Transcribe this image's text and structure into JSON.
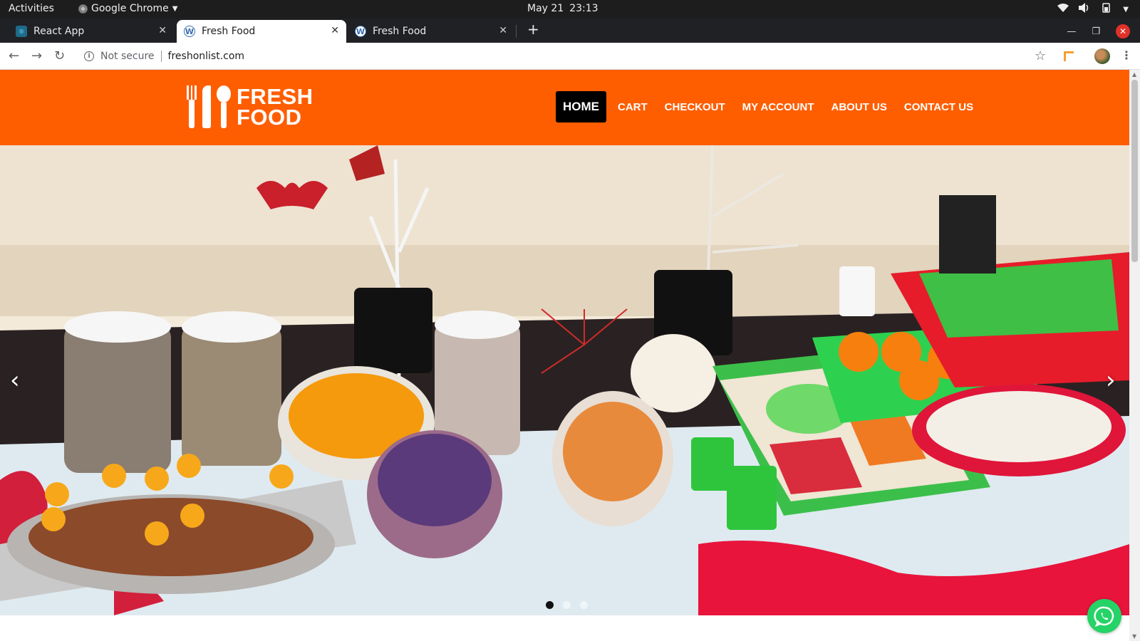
{
  "os_bar": {
    "activities": "Activities",
    "app_name": "Google Chrome",
    "date": "May 21",
    "time": "23:13"
  },
  "browser": {
    "tabs": [
      {
        "title": "React App",
        "icon": "react-icon"
      },
      {
        "title": "Fresh Food",
        "icon": "wordpress-icon",
        "active": true
      },
      {
        "title": "Fresh Food",
        "icon": "wordpress-icon"
      }
    ],
    "security_label": "Not secure",
    "url": "freshonlist.com"
  },
  "site": {
    "logo_line1": "FRESH",
    "logo_line2": "FOOD",
    "nav": [
      {
        "label": "HOME",
        "active": true
      },
      {
        "label": "CART"
      },
      {
        "label": "CHECKOUT"
      },
      {
        "label": "MY ACCOUNT"
      },
      {
        "label": "ABOUT US"
      },
      {
        "label": "CONTACT US"
      }
    ],
    "brand_color": "#ff5e00",
    "slider": {
      "slide_count": 3,
      "active_slide": 1,
      "image_subject": "halloween-party-food-table"
    }
  }
}
